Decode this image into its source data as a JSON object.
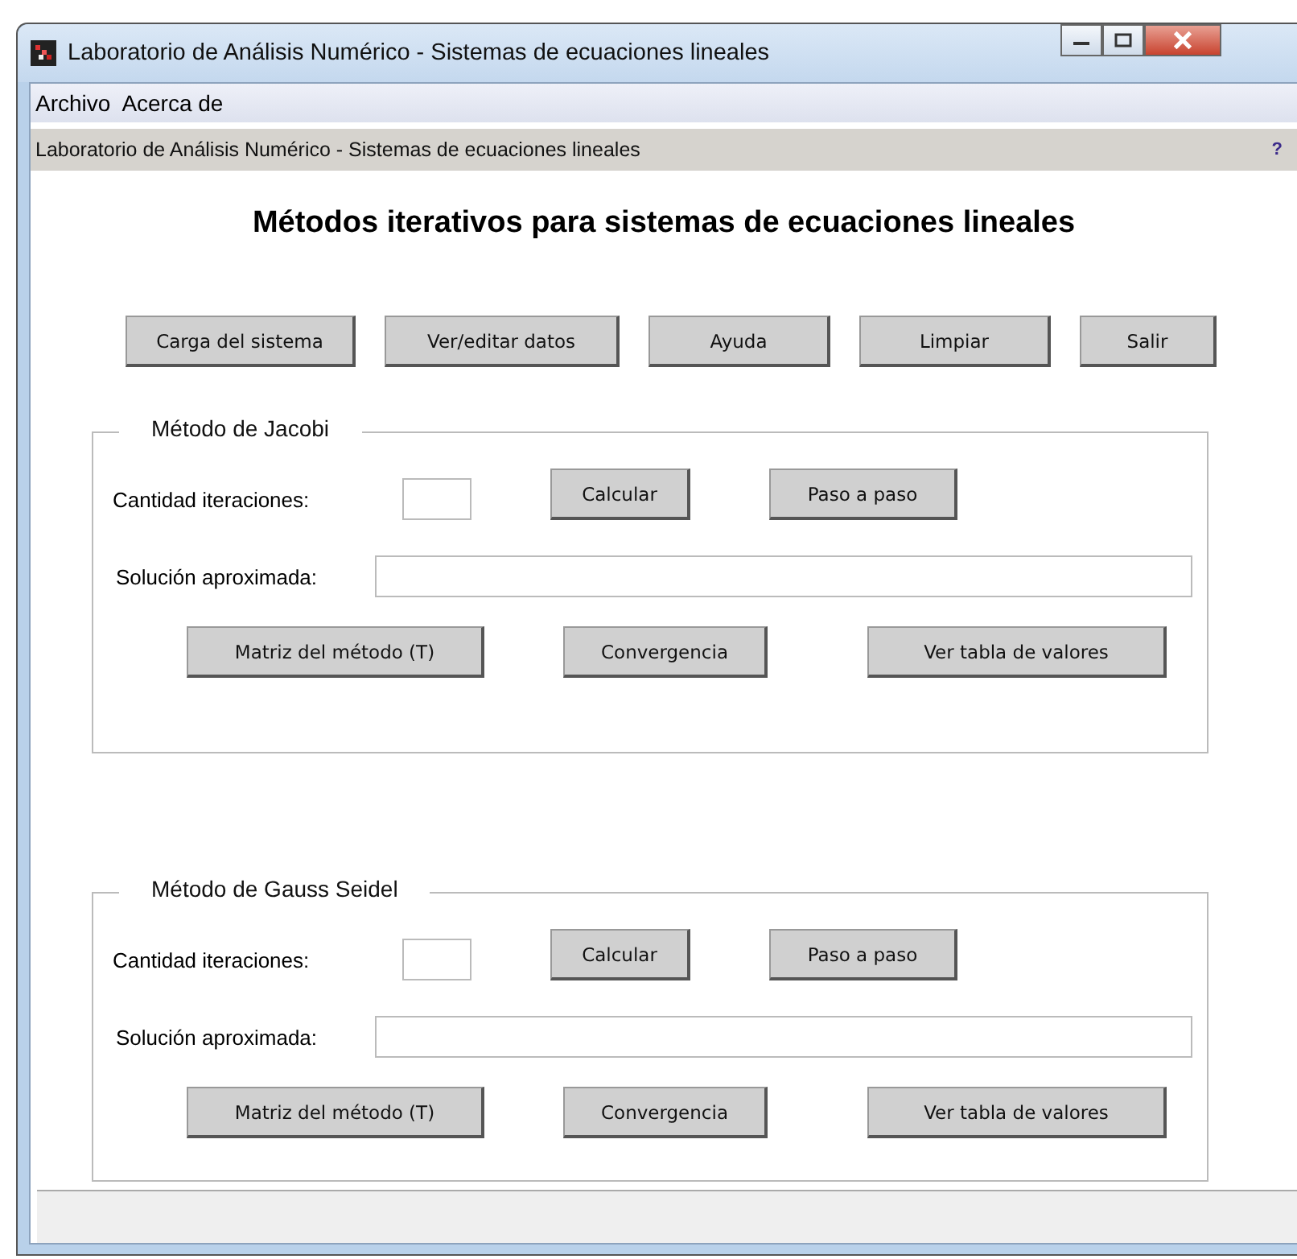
{
  "window": {
    "title": "Laboratorio de Análisis Numérico - Sistemas de ecuaciones lineales"
  },
  "menu": [
    "Archivo",
    "Acerca de"
  ],
  "header": {
    "text": "Laboratorio de Análisis Numérico - Sistemas de ecuaciones lineales",
    "help": "?"
  },
  "heading": "Métodos iterativos para sistemas de ecuaciones lineales",
  "toolbar": [
    "Carga del sistema",
    "Ver/editar datos",
    "Ayuda",
    "Limpiar",
    "Salir"
  ],
  "methods": [
    {
      "title": "Método de Jacobi",
      "iterations_label": "Cantidad iteraciones:",
      "actions": [
        "Calcular",
        "Paso a paso"
      ],
      "solution_label": "Solución aproximada:",
      "buttons": [
        "Matriz del método (T)",
        "Convergencia",
        "Ver tabla de valores"
      ]
    },
    {
      "title": "Método de Gauss Seidel",
      "iterations_label": "Cantidad iteraciones:",
      "actions": [
        "Calcular",
        "Paso a paso"
      ],
      "solution_label": "Solución aproximada:",
      "buttons": [
        "Matriz del método (T)",
        "Convergencia",
        "Ver tabla de valores"
      ]
    }
  ]
}
